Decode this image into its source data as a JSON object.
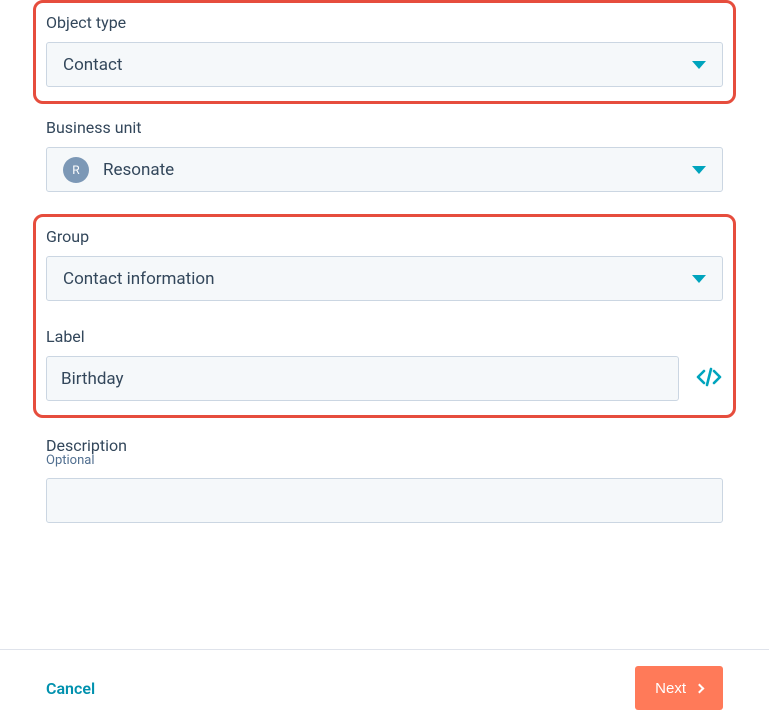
{
  "form": {
    "object_type": {
      "label": "Object type",
      "value": "Contact"
    },
    "business_unit": {
      "label": "Business unit",
      "value": "Resonate",
      "avatar_letter": "R"
    },
    "group": {
      "label": "Group",
      "value": "Contact information"
    },
    "label_field": {
      "label": "Label",
      "value": "Birthday"
    },
    "description": {
      "label": "Description",
      "hint": "Optional",
      "value": ""
    }
  },
  "footer": {
    "cancel": "Cancel",
    "next": "Next"
  }
}
